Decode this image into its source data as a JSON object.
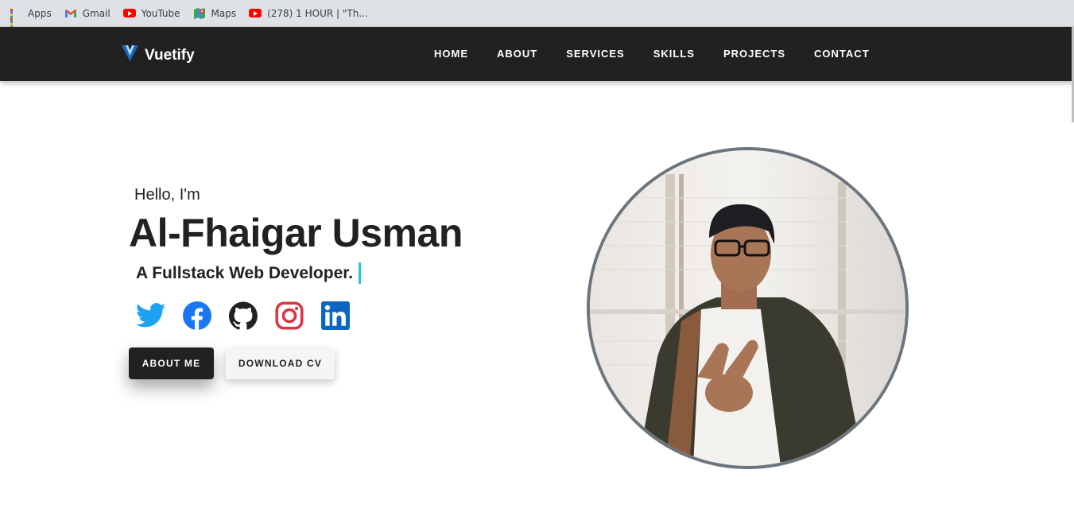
{
  "bookmarks": [
    {
      "label": "Apps",
      "icon": "apps-grid-icon"
    },
    {
      "label": "Gmail",
      "icon": "gmail-icon"
    },
    {
      "label": "YouTube",
      "icon": "youtube-icon"
    },
    {
      "label": "Maps",
      "icon": "maps-icon"
    },
    {
      "label": "(278) 1 HOUR | \"Th...",
      "icon": "youtube-icon"
    }
  ],
  "nav": {
    "brand": "Vuetify",
    "links": [
      "HOME",
      "ABOUT",
      "SERVICES",
      "SKILLS",
      "PROJECTS",
      "CONTACT"
    ]
  },
  "hero": {
    "greeting": "Hello, I'm",
    "name": "Al-Fhaigar Usman",
    "role": "A Fullstack Web Developer.",
    "socials": [
      {
        "name": "twitter",
        "color": "#1da1f2"
      },
      {
        "name": "facebook",
        "color": "#1877f2"
      },
      {
        "name": "github",
        "color": "#212121"
      },
      {
        "name": "instagram",
        "color": "#e1306c"
      },
      {
        "name": "linkedin",
        "color": "#0a66c2"
      }
    ],
    "buttons": {
      "primary": "ABOUT ME",
      "secondary": "DOWNLOAD CV"
    }
  },
  "colors": {
    "navbar": "#212121",
    "cursor": "#26c6da",
    "portrait_border": "#6c757d"
  }
}
